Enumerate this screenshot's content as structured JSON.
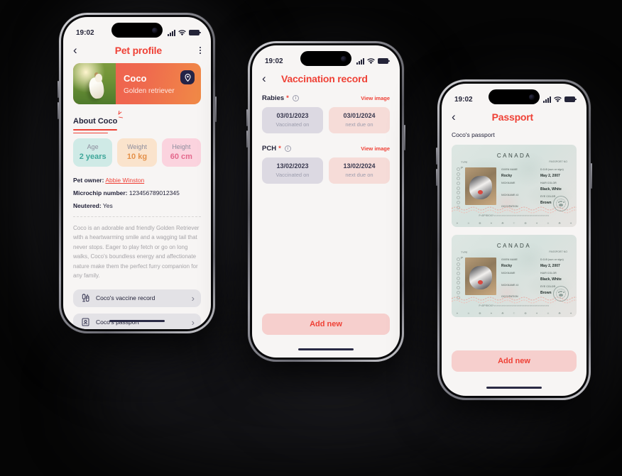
{
  "scene": {
    "background": "#050505",
    "accent": "#ef4136",
    "navy": "#23233a"
  },
  "phones": [
    {
      "id": "pet-profile",
      "status": {
        "time": "19:02",
        "signal_icon": "cellular-bars-icon",
        "wifi_icon": "wifi-icon",
        "battery_icon": "battery-icon"
      },
      "nav": {
        "back_icon": "chevron-left-icon",
        "title": "Pet profile",
        "menu_icon": "more-vertical-icon"
      },
      "pet": {
        "photo_alt": "dog-photo",
        "name": "Coco",
        "breed": "Golden retriever",
        "pin_icon": "location-pin-icon"
      },
      "about": {
        "heading": "About Coco",
        "sparkle_icon": "sparkle-icon"
      },
      "stats": [
        {
          "key": "Age",
          "value": "2 years",
          "bg": "#cfeae6",
          "fg": "#3fa79a"
        },
        {
          "key": "Weight",
          "value": "10 kg",
          "bg": "#fae3cc",
          "fg": "#e4914a"
        },
        {
          "key": "Height",
          "value": "60 cm",
          "bg": "#fbd3de",
          "fg": "#e4698d"
        }
      ],
      "details": [
        {
          "label": "Pet owner:",
          "value": "Abbie Winston",
          "link": true
        },
        {
          "label": "Microchip number:",
          "value": "123456789012345",
          "link": false
        },
        {
          "label": "Neutered:",
          "value": "Yes",
          "link": false
        }
      ],
      "description": "Coco is an adorable and friendly Golden Retriever with a heartwarming smile and a wagging tail that never stops. Eager to play fetch or go on long walks, Coco's boundless energy and affectionate nature make them the perfect furry companion for any family.",
      "actions": [
        {
          "icon": "syringe-icon",
          "label": "Coco's vaccine record",
          "chevron": "›"
        },
        {
          "icon": "passport-icon",
          "label": "Coco's passport",
          "chevron": "›"
        }
      ]
    },
    {
      "id": "vaccination-record",
      "status": {
        "time": "19:02",
        "signal_icon": "cellular-bars-icon",
        "wifi_icon": "wifi-icon",
        "battery_icon": "battery-icon"
      },
      "nav": {
        "back_icon": "chevron-left-icon",
        "title": "Vaccination record"
      },
      "vaccines": [
        {
          "name": "Rabies",
          "required_mark": "*",
          "info_icon": "info-circle-icon",
          "view_image": "View image",
          "given": {
            "date": "03/01/2023",
            "caption": "Vaccinated on"
          },
          "due": {
            "date": "03/01/2024",
            "caption": "next due on"
          }
        },
        {
          "name": "PCH",
          "required_mark": "*",
          "info_icon": "info-circle-icon",
          "view_image": "View image",
          "given": {
            "date": "13/02/2023",
            "caption": "Vaccinated on"
          },
          "due": {
            "date": "13/02/2024",
            "caption": "next due on"
          }
        }
      ],
      "add_button": "Add new"
    },
    {
      "id": "passport",
      "status": {
        "time": "19:02",
        "signal_icon": "cellular-bars-icon",
        "wifi_icon": "wifi-icon",
        "battery_icon": "battery-icon"
      },
      "nav": {
        "back_icon": "chevron-left-icon",
        "title": "Passport"
      },
      "section_label": "Coco's passport",
      "cards": [
        {
          "country": "CANADA",
          "type_key": "TYPE",
          "type_val": "P",
          "passport_no_key": "PASSPORT NO",
          "photo_alt": "dog-passport-photo",
          "left_fields": [
            {
              "key": "GIVEN NAME",
              "value": "Rocky"
            },
            {
              "key": "NICKNAME",
              "value": ""
            },
            {
              "key": "NICKNAME #2",
              "value": ""
            },
            {
              "key": "OCCUPATION",
              "value": ""
            }
          ],
          "right_fields": [
            {
              "key": "D.O.B (sun or sign)",
              "value": "May 2, 2007"
            },
            {
              "key": "HAIR COLOR",
              "value": "Black, White"
            },
            {
              "key": "EYE COLOR",
              "value": "Brown"
            }
          ],
          "mrz": "P<DPROCKY<<<<<<<<<<<<<<<<<<<<<<<<<<<<<<<<<<",
          "stamp_icon": "paw-stamp-icon"
        },
        {
          "country": "CANADA",
          "type_key": "TYPE",
          "type_val": "P",
          "passport_no_key": "PASSPORT NO",
          "photo_alt": "dog-passport-photo",
          "left_fields": [
            {
              "key": "GIVEN NAME",
              "value": "Rocky"
            },
            {
              "key": "NICKNAME",
              "value": ""
            },
            {
              "key": "NICKNAME #2",
              "value": ""
            },
            {
              "key": "OCCUPATION",
              "value": ""
            }
          ],
          "right_fields": [
            {
              "key": "D.O.B (sun or sign)",
              "value": "May 2, 2007"
            },
            {
              "key": "HAIR COLOR",
              "value": "Black, White"
            },
            {
              "key": "EYE COLOR",
              "value": "Brown"
            }
          ],
          "mrz": "P<DPROCKY<<<<<<<<<<<<<<<<<<<<<<<<<<<<<<<<<<",
          "stamp_icon": "paw-stamp-icon"
        }
      ],
      "add_button": "Add new"
    }
  ]
}
